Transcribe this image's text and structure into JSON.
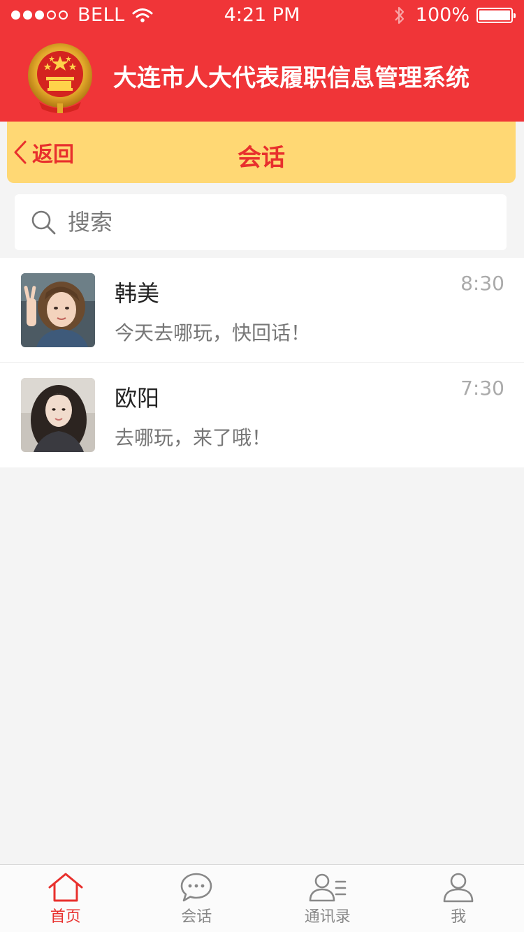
{
  "status_bar": {
    "carrier": "BELL",
    "time": "4:21 PM",
    "battery_percent": "100%",
    "signal_bars_filled": 3,
    "signal_bars_total": 5,
    "battery_level": 1.0
  },
  "header": {
    "title": "大连市人大代表履职信息管理系统",
    "emblem_icon": "national-emblem-icon"
  },
  "nav": {
    "back_label": "返回",
    "title": "会话"
  },
  "search": {
    "placeholder": "搜索"
  },
  "conversations": [
    {
      "name": "韩美",
      "message": "今天去哪玩，快回话！",
      "time": "8:30"
    },
    {
      "name": "欧阳",
      "message": "去哪玩，来了哦！",
      "time": "7:30"
    }
  ],
  "tabs": [
    {
      "label": "首页",
      "icon": "home-icon",
      "active": true
    },
    {
      "label": "会话",
      "icon": "chat-bubble-icon",
      "active": false
    },
    {
      "label": "通讯录",
      "icon": "contacts-icon",
      "active": false
    },
    {
      "label": "我",
      "icon": "user-icon",
      "active": false
    }
  ],
  "colors": {
    "header_red": "#f03538",
    "nav_yellow": "#ffd874",
    "accent_red": "#e8302d",
    "background": "#f4f4f4"
  }
}
